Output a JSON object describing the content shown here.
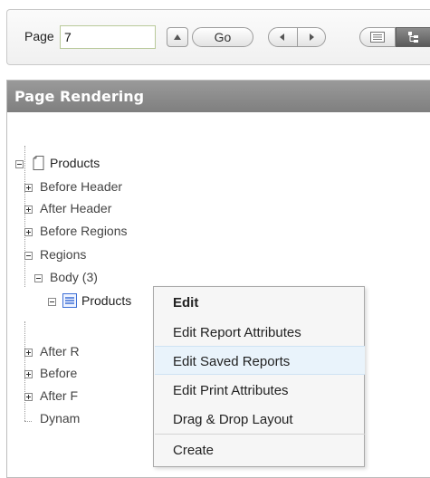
{
  "toolbar": {
    "page_label": "Page",
    "page_value": "7",
    "go_label": "Go"
  },
  "panel": {
    "title": "Page Rendering"
  },
  "tree": {
    "root": "Products",
    "before_header": "Before Header",
    "after_header": "After Header",
    "before_regions": "Before Regions",
    "regions": "Regions",
    "body": "Body (3)",
    "products_region": "Products",
    "after_regions_partial": "After R",
    "before_footer_partial": "Before",
    "after_footer_partial": "After F",
    "dynamic_partial": "Dynam"
  },
  "context_menu": {
    "items": [
      "Edit",
      "Edit Report Attributes",
      "Edit Saved Reports",
      "Edit Print Attributes",
      "Drag & Drop Layout",
      "Create"
    ],
    "highlighted": "Edit Saved Reports"
  },
  "colors": {
    "header_bg": "#8a8a8a",
    "highlight_bg": "#e9f3fb",
    "input_border": "#b9c99a",
    "report_icon_blue": "#3d6fd6"
  }
}
